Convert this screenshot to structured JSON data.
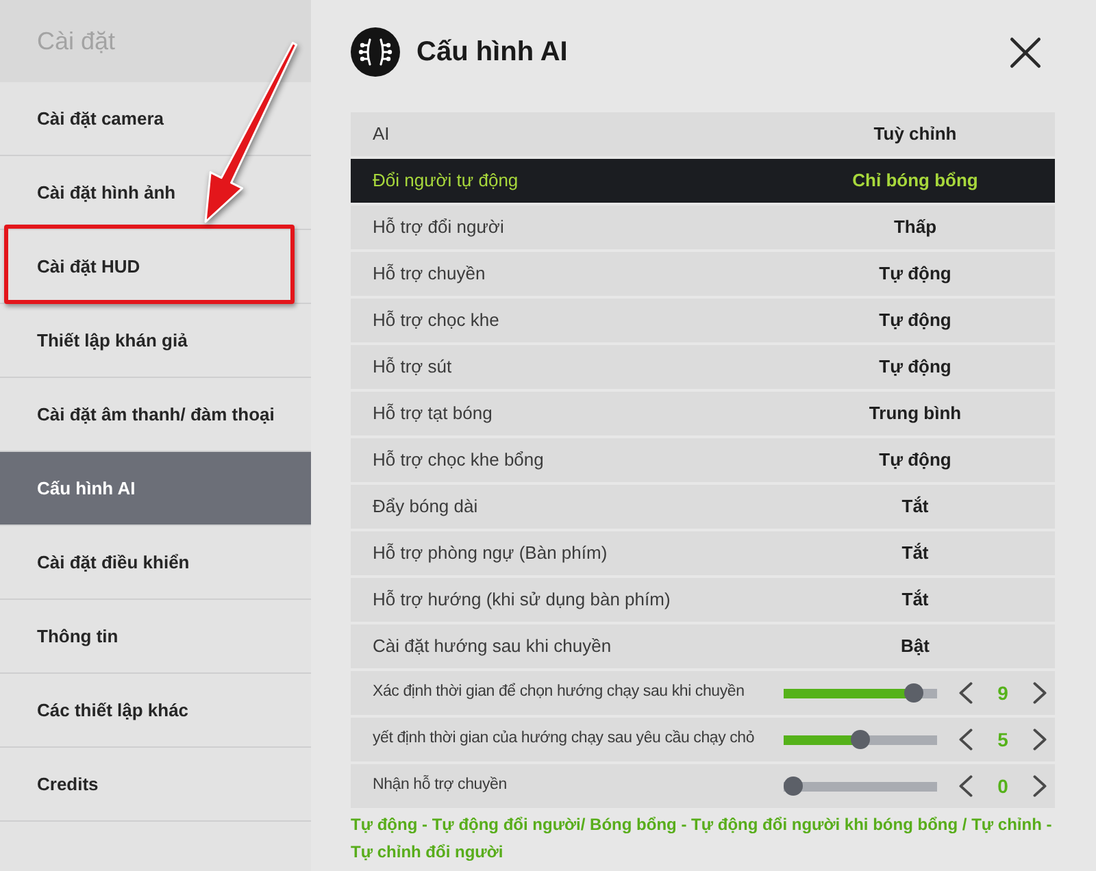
{
  "sidebar": {
    "title": "Cài đặt",
    "items": [
      {
        "label": "Cài đặt camera",
        "selected": false,
        "highlighted": false
      },
      {
        "label": "Cài đặt hình ảnh",
        "selected": false,
        "highlighted": false
      },
      {
        "label": "Cài đặt HUD",
        "selected": false,
        "highlighted": true
      },
      {
        "label": "Thiết lập khán giả",
        "selected": false,
        "highlighted": false
      },
      {
        "label": "Cài đặt âm thanh/ đàm thoại",
        "selected": false,
        "highlighted": false
      },
      {
        "label": "Cấu hình AI",
        "selected": true,
        "highlighted": false
      },
      {
        "label": "Cài đặt điều khiển",
        "selected": false,
        "highlighted": false
      },
      {
        "label": "Thông tin",
        "selected": false,
        "highlighted": false
      },
      {
        "label": "Các thiết lập khác",
        "selected": false,
        "highlighted": false
      },
      {
        "label": "Credits",
        "selected": false,
        "highlighted": false
      }
    ]
  },
  "panel": {
    "title": "Cấu hình AI"
  },
  "settings": [
    {
      "kind": "option",
      "label": "AI",
      "value": "Tuỳ chỉnh",
      "selected": false
    },
    {
      "kind": "option",
      "label": "Đổi người tự động",
      "value": "Chỉ bóng bổng",
      "selected": true
    },
    {
      "kind": "option",
      "label": "Hỗ trợ đổi người",
      "value": "Thấp",
      "selected": false
    },
    {
      "kind": "option",
      "label": "Hỗ trợ chuyền",
      "value": "Tự động",
      "selected": false
    },
    {
      "kind": "option",
      "label": "Hỗ trợ chọc khe",
      "value": "Tự động",
      "selected": false
    },
    {
      "kind": "option",
      "label": "Hỗ trợ sút",
      "value": "Tự động",
      "selected": false
    },
    {
      "kind": "option",
      "label": "Hỗ trợ tạt bóng",
      "value": "Trung bình",
      "selected": false
    },
    {
      "kind": "option",
      "label": "Hỗ trợ chọc khe bổng",
      "value": "Tự động",
      "selected": false
    },
    {
      "kind": "option",
      "label": "Đẩy bóng dài",
      "value": "Tắt",
      "selected": false
    },
    {
      "kind": "option",
      "label": "Hỗ trợ phòng ngự (Bàn phím)",
      "value": "Tắt",
      "selected": false
    },
    {
      "kind": "option",
      "label": "Hỗ trợ hướng (khi sử dụng bàn phím)",
      "value": "Tắt",
      "selected": false
    },
    {
      "kind": "option",
      "label": "Cài đặt hướng sau khi chuyền",
      "value": "Bật",
      "selected": false
    },
    {
      "kind": "slider",
      "label": "Xác định thời gian để chọn hướng chạy sau khi chuyền",
      "level": 0.9,
      "value": "9",
      "selected": false
    },
    {
      "kind": "slider",
      "label": "yết định thời gian của hướng chạy sau yêu cầu chạy chỏ",
      "level": 0.5,
      "value": "5",
      "selected": false
    },
    {
      "kind": "slider",
      "label": "Nhận hỗ trợ chuyền",
      "level": 0,
      "value": "0",
      "selected": false
    }
  ],
  "legend": "Tự động - Tự động đổi người/ Bóng bổng - Tự động đổi người khi bóng bổng / Tự chỉnh - Tự chỉnh đổi người"
}
